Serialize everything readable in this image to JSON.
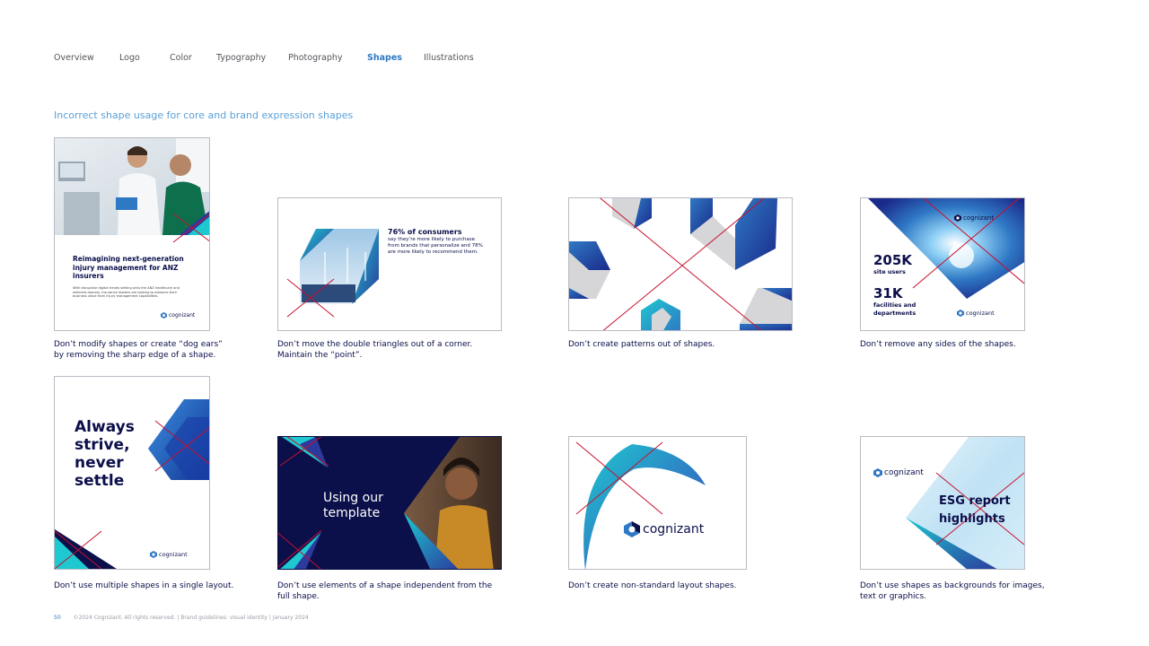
{
  "nav": {
    "items": [
      "Overview",
      "Logo",
      "Color",
      "Typography",
      "Photography",
      "Shapes",
      "Illustrations"
    ],
    "active": "Shapes"
  },
  "section_title": "Incorrect shape usage for core and brand expression shapes",
  "brand": {
    "logo_text": "cognizant"
  },
  "colors": {
    "navy": "#0b0f4a",
    "blue": "#2f78c4",
    "teal": "#1ec8d0",
    "red_x": "#c8102e",
    "light_blue": "#5aa0d8"
  },
  "cards": {
    "c1": {
      "headline": "Reimagining next-generation injury management for ANZ insurers",
      "body": "With disruptive digital trends setting onto the ANZ healthcare and wellness domain, insurance leaders are looking to advance their business value from injury management capabilities.",
      "caption": "Don’t modify shapes or create “dog ears” by removing the sharp edge of a shape."
    },
    "c2": {
      "stat": "76% of consumers",
      "stat_body": "say they’re more likely to purchase from brands that personalize and 78% are more likely to recommend them.",
      "caption": "Don’t move the double triangles out of a corner. Maintain the “point”."
    },
    "c3": {
      "caption": "Don’t create patterns out of shapes."
    },
    "c4": {
      "stat1": "205K",
      "stat1_label": "site users",
      "stat2": "31K",
      "stat2_label": "facilities and departments",
      "caption": "Don’t remove any sides of the shapes."
    },
    "c5": {
      "headline": "Always strive, never settle",
      "caption": "Don’t use multiple shapes in a single layout."
    },
    "c6": {
      "headline": "Using our template",
      "caption": "Don’t use elements of a shape independent from the full shape."
    },
    "c7": {
      "caption": "Don’t create non-standard layout shapes."
    },
    "c8": {
      "headline": "ESG report highlights",
      "caption": "Don’t use shapes as backgrounds for images, text or graphics."
    }
  },
  "footer": {
    "page": "50",
    "text": "©2024 Cognizant. All rights reserved.  |  Brand guidelines: visual identity  |  January 2024"
  }
}
